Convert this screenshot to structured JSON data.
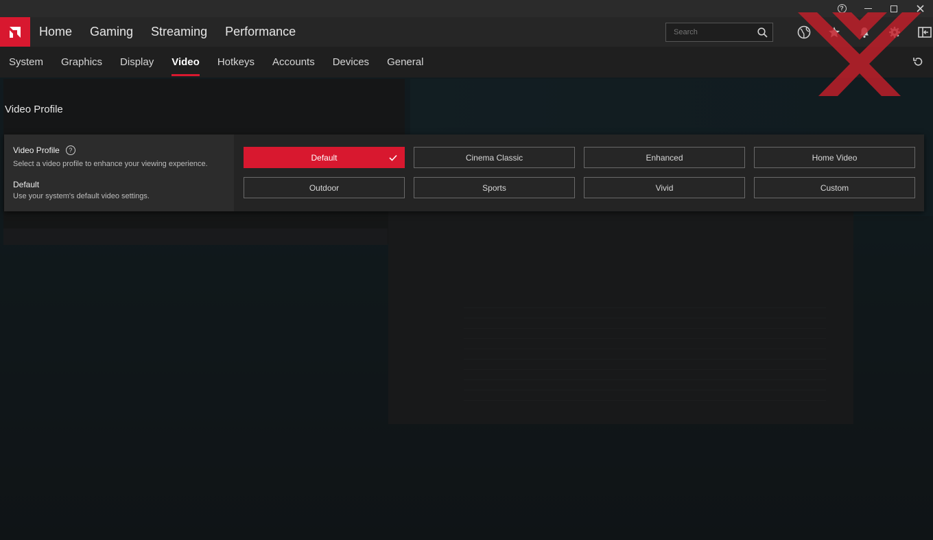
{
  "window": {
    "controls": [
      "help-icon",
      "minimize-icon",
      "maximize-icon",
      "close-icon"
    ]
  },
  "main_nav": {
    "tabs": [
      "Home",
      "Gaming",
      "Streaming",
      "Performance"
    ],
    "search_placeholder": "Search",
    "icons": [
      "globe-icon",
      "star-icon",
      "bell-icon",
      "gear-icon",
      "sidebar-toggle-icon"
    ]
  },
  "sub_nav": {
    "tabs": [
      "System",
      "Graphics",
      "Display",
      "Video",
      "Hotkeys",
      "Accounts",
      "Devices",
      "General"
    ],
    "active": "Video"
  },
  "page": {
    "title": "Video Profile"
  },
  "profile_panel": {
    "heading": "Video Profile",
    "description": "Select a video profile to enhance your viewing experience.",
    "selected_name": "Default",
    "selected_description": "Use your system's default video settings.",
    "options": [
      "Default",
      "Cinema Classic",
      "Enhanced",
      "Home Video",
      "Outdoor",
      "Sports",
      "Vivid",
      "Custom"
    ],
    "selected_option": "Default"
  },
  "colors": {
    "accent": "#d8182f",
    "nav_bg": "#262626",
    "subnav_bg": "#1f1f1f"
  }
}
